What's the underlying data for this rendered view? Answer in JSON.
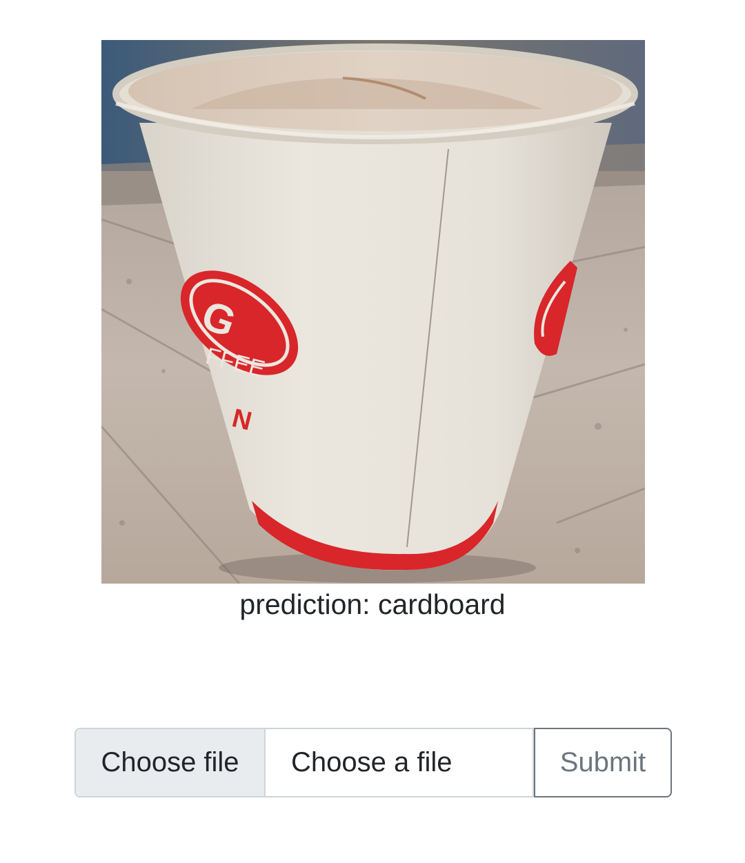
{
  "image": {
    "alt": "",
    "logo_text": "G",
    "logo_subtext": "FFEE",
    "logo_fragment": "N"
  },
  "result": {
    "prediction": "prediction: cardboard"
  },
  "form": {
    "choose_button_label": "Choose file",
    "file_placeholder": "Choose a file",
    "submit_label": "Submit"
  },
  "colors": {
    "cup_red": "#d8262a",
    "cup_white": "#ebe7df",
    "table": "#b9ada2",
    "submit_border": "#6c757d",
    "input_border": "#ced4da",
    "choose_bg": "#e9ecef"
  }
}
